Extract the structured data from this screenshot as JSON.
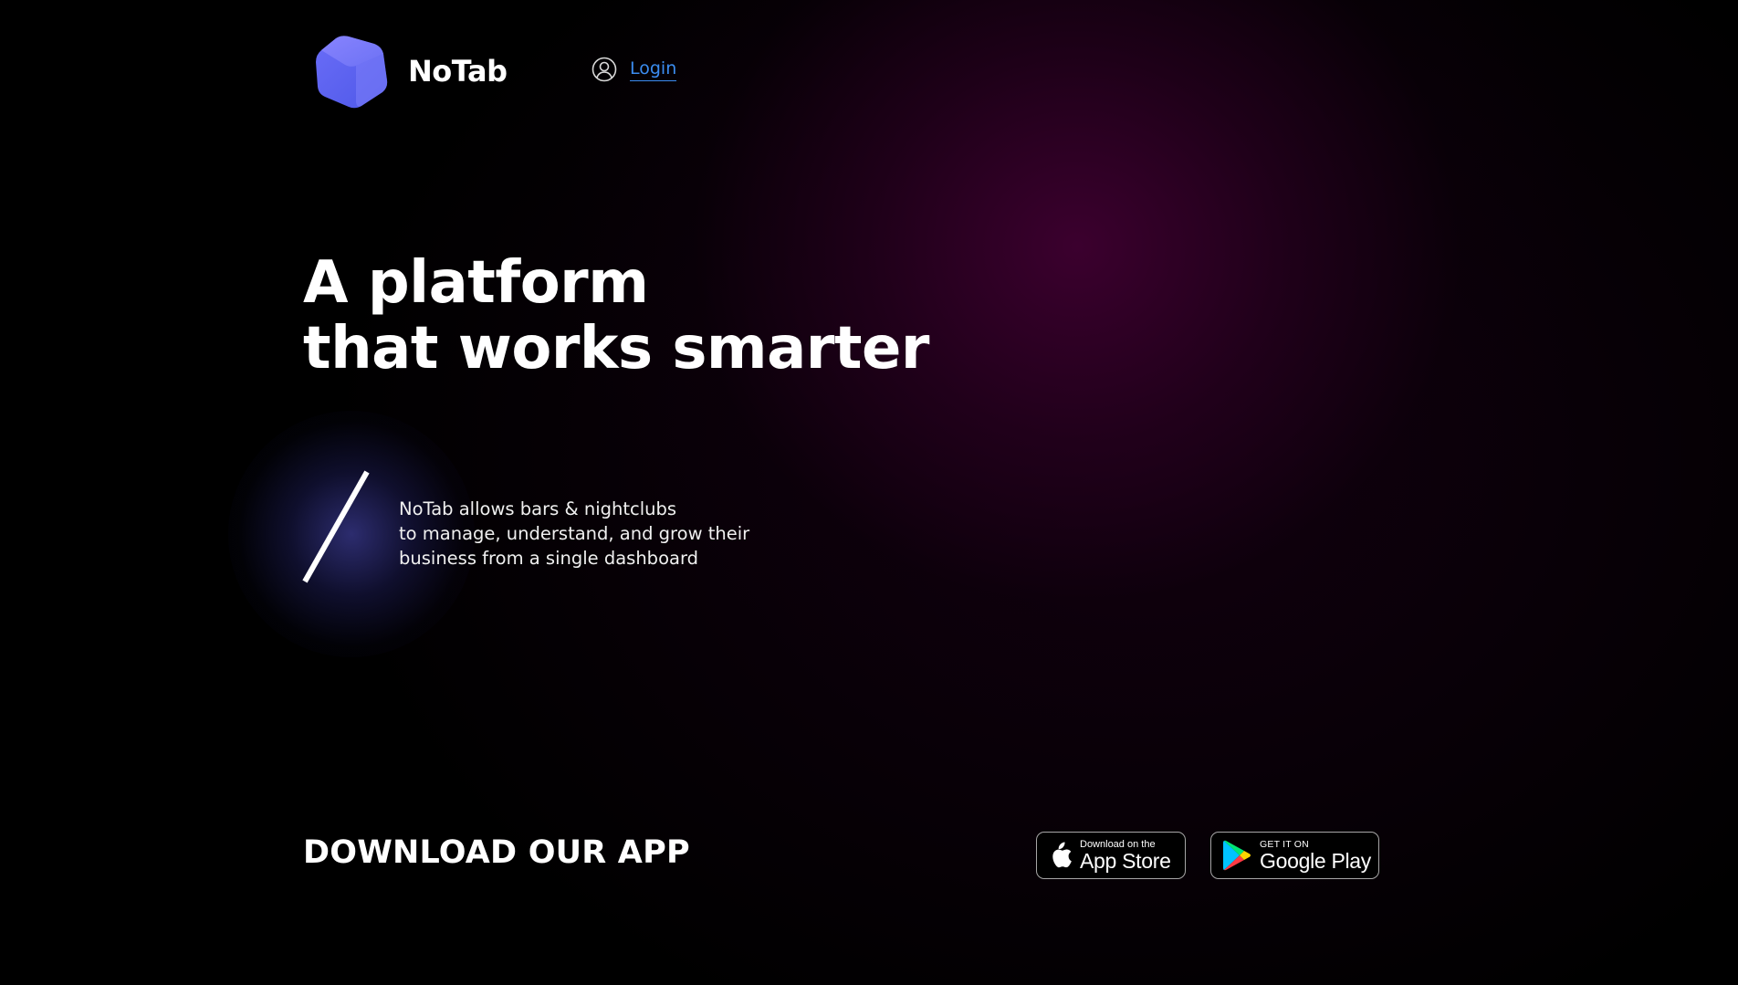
{
  "header": {
    "brand_name": "NoTab",
    "logo_icon": "cube-logo-icon",
    "login_icon": "user-circle-icon",
    "login_label": "Login"
  },
  "hero": {
    "title_line1": "A platform",
    "title_line2": "that works smarter",
    "description_line1": "NoTab allows bars & nightclubs",
    "description_line2": "to manage, understand, and grow their",
    "description_line3": "business from a single dashboard"
  },
  "download": {
    "heading": "DOWNLOAD OUR APP",
    "app_store": {
      "icon": "apple-icon",
      "small_text": "Download on the",
      "big_text": "App Store"
    },
    "google_play": {
      "icon": "google-play-icon",
      "small_text": "GET IT ON",
      "big_text": "Google Play"
    }
  },
  "colors": {
    "background": "#000000",
    "glow_magenta": "#3e0030",
    "glow_blue": "#343482",
    "link_blue": "#3b8cf0",
    "logo_gradient_start": "#5b5ff0",
    "logo_gradient_end": "#8a7dff",
    "text": "#ffffff"
  }
}
